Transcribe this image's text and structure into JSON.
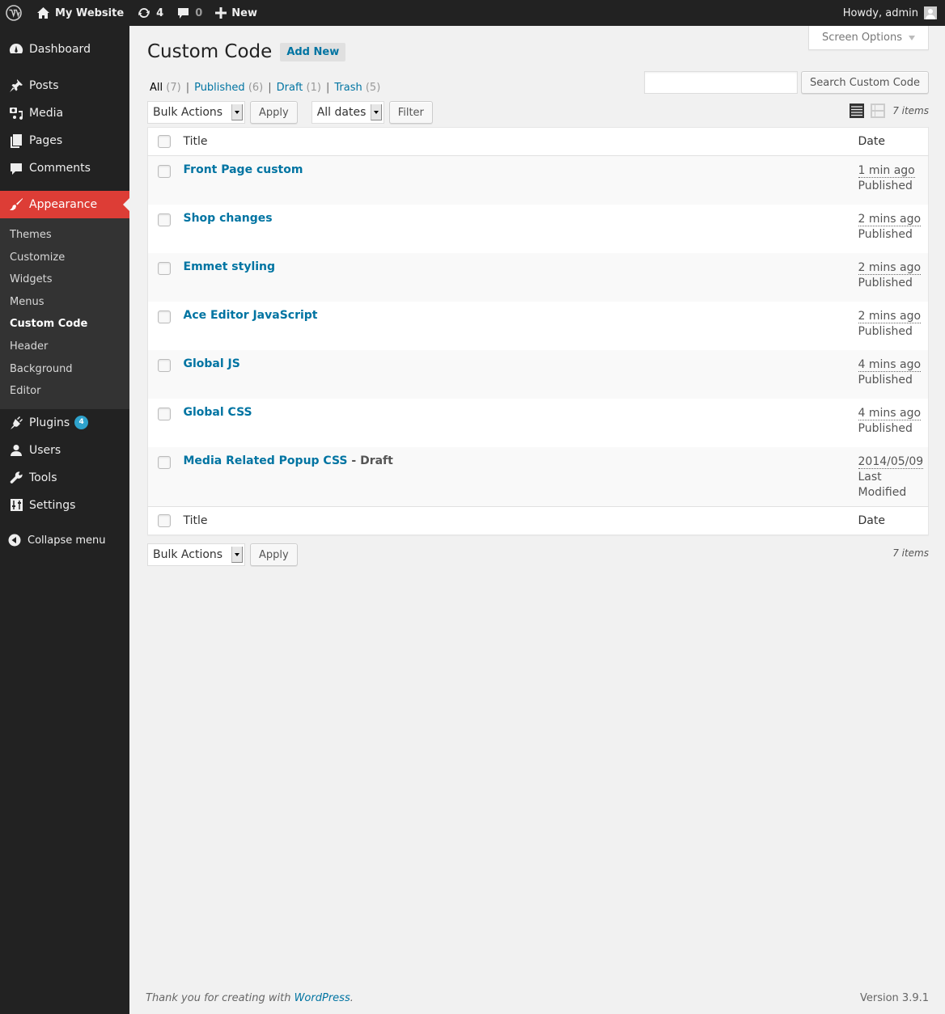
{
  "adminbar": {
    "site_name": "My Website",
    "updates_count": "4",
    "comments_count": "0",
    "new_label": "New",
    "howdy": "Howdy, admin"
  },
  "sidebar": {
    "items": [
      {
        "label": "Dashboard",
        "icon": "dashboard-icon"
      },
      {
        "label": "Posts",
        "icon": "pin-icon"
      },
      {
        "label": "Media",
        "icon": "media-icon"
      },
      {
        "label": "Pages",
        "icon": "pages-icon"
      },
      {
        "label": "Comments",
        "icon": "comment-icon"
      },
      {
        "label": "Appearance",
        "icon": "brush-icon",
        "current": true
      },
      {
        "label": "Plugins",
        "icon": "plug-icon",
        "badge": "4"
      },
      {
        "label": "Users",
        "icon": "user-icon"
      },
      {
        "label": "Tools",
        "icon": "wrench-icon"
      },
      {
        "label": "Settings",
        "icon": "settings-icon"
      }
    ],
    "submenu": [
      "Themes",
      "Customize",
      "Widgets",
      "Menus",
      "Custom Code",
      "Header",
      "Background",
      "Editor"
    ],
    "collapse_label": "Collapse menu"
  },
  "screen_options": "Screen Options",
  "page": {
    "title": "Custom Code",
    "add_new": "Add New"
  },
  "filters": {
    "all": {
      "label": "All",
      "count": "(7)"
    },
    "published": {
      "label": "Published",
      "count": "(6)"
    },
    "draft": {
      "label": "Draft",
      "count": "(1)"
    },
    "trash": {
      "label": "Trash",
      "count": "(5)"
    },
    "sep": "|"
  },
  "search": {
    "value": "",
    "button": "Search Custom Code"
  },
  "tablenav": {
    "bulk_actions": "Bulk Actions",
    "apply": "Apply",
    "dates": "All dates",
    "filter": "Filter",
    "items_count": "7 items"
  },
  "table": {
    "columns": {
      "title": "Title",
      "date": "Date"
    },
    "rows": [
      {
        "title": "Front Page custom",
        "state": "",
        "date": "1 min ago",
        "status": "Published"
      },
      {
        "title": "Shop changes",
        "state": "",
        "date": "2 mins ago",
        "status": "Published"
      },
      {
        "title": "Emmet styling",
        "state": "",
        "date": "2 mins ago",
        "status": "Published"
      },
      {
        "title": "Ace Editor JavaScript",
        "state": "",
        "date": "2 mins ago",
        "status": "Published"
      },
      {
        "title": "Global JS",
        "state": "",
        "date": "4 mins ago",
        "status": "Published"
      },
      {
        "title": "Global CSS",
        "state": "",
        "date": "4 mins ago",
        "status": "Published"
      },
      {
        "title": "Media Related Popup CSS",
        "state": " - Draft",
        "date": "2014/05/09",
        "status": "Last Modified"
      }
    ]
  },
  "footer": {
    "thanks_prefix": "Thank you for creating with ",
    "thanks_link": "WordPress",
    "thanks_suffix": ".",
    "version": "Version 3.9.1"
  }
}
